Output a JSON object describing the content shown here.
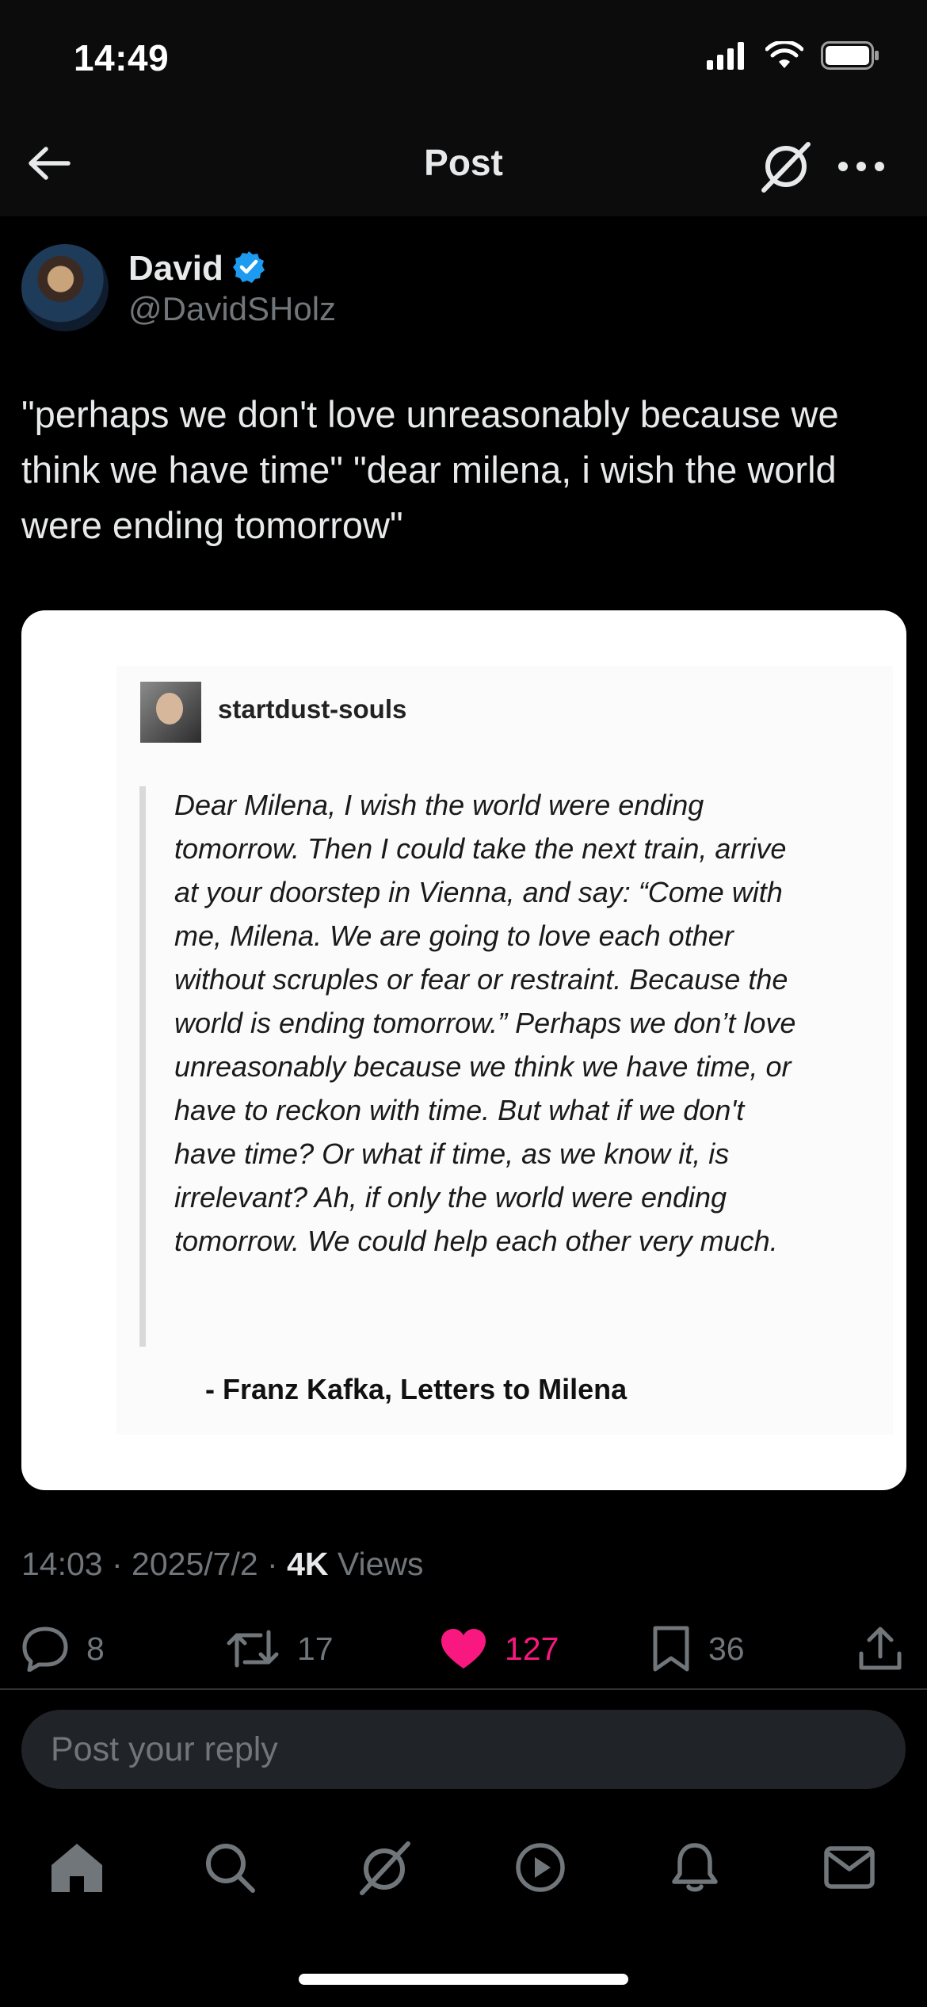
{
  "status_bar": {
    "time": "14:49"
  },
  "header": {
    "title": "Post"
  },
  "author": {
    "name": "David",
    "handle": "@DavidSHolz"
  },
  "tweet": {
    "text": "\"perhaps we don't love unreasonably because we think we have time\" \"dear milena, i wish the world were ending tomorrow\""
  },
  "media": {
    "username": "startdust-souls",
    "quote": "Dear Milena, I wish the world were ending tomorrow. Then I could take the next train, arrive at your doorstep in Vienna, and say: “Come with me, Milena. We are going to love each other without scruples or fear or restraint. Because the world is ending tomorrow.” Perhaps we don’t love unreasonably because we think we have time, or have to reckon with time. But what if we don't have time? Or what if time, as we know it, is irrelevant? Ah, if only the world were ending tomorrow. We could help each other very much.",
    "attribution": "- Franz Kafka, Letters to Milena"
  },
  "meta": {
    "time": "14:03",
    "date": "2025/7/2",
    "views_count": "4K",
    "views_label": "Views"
  },
  "actions": {
    "replies": "8",
    "reposts": "17",
    "likes": "127",
    "bookmarks": "36"
  },
  "reply": {
    "placeholder": "Post your reply"
  },
  "colors": {
    "like": "#f91880",
    "verified": "#1d9bf0",
    "muted": "#71767b"
  }
}
